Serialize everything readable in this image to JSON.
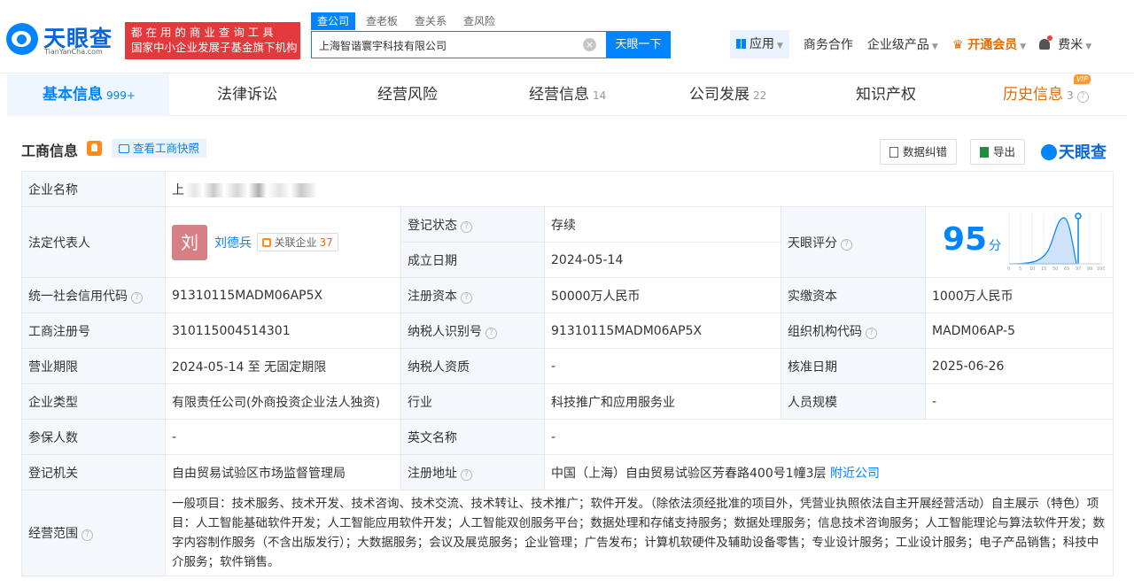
{
  "brand": {
    "name": "天眼查",
    "domain": "TianYanCha.com",
    "slogan_line1": "都 在 用 的 商 业 查 询 工 具",
    "slogan_line2": "国家中小企业发展子基金旗下机构"
  },
  "search": {
    "tabs": [
      "查公司",
      "查老板",
      "查关系",
      "查风险"
    ],
    "value": "上海智谐寰宇科技有限公司",
    "button": "天眼一下"
  },
  "nav": {
    "app": "应用",
    "items": [
      "商务合作",
      "企业级产品"
    ],
    "vip": "开通会员",
    "user": "费米"
  },
  "tabs": [
    {
      "label": "基本信息",
      "count": "999+"
    },
    {
      "label": "法律诉讼",
      "count": ""
    },
    {
      "label": "经营风险",
      "count": ""
    },
    {
      "label": "经营信息",
      "count": "14"
    },
    {
      "label": "公司发展",
      "count": "22"
    },
    {
      "label": "知识产权",
      "count": ""
    },
    {
      "label": "历史信息",
      "count": "3",
      "badge": "VIP"
    }
  ],
  "section": {
    "title": "工商信息",
    "snapshot": "查看工商快照",
    "correct": "数据纠错",
    "export": "导出",
    "brand": "天眼查"
  },
  "info": {
    "company_name_label": "企业名称",
    "company_name": "上",
    "legal_label": "法定代表人",
    "legal_avatar": "刘",
    "legal_name": "刘德兵",
    "related_label": "关联企业",
    "related_count": "37",
    "status_label": "登记状态",
    "status": "存续",
    "found_label": "成立日期",
    "found": "2024-05-14",
    "score_label": "天眼评分",
    "score": "95",
    "score_unit": "分",
    "score_ticks": [
      "0",
      "5",
      "10",
      "15",
      "50",
      "65",
      "97",
      "99",
      "100"
    ],
    "credit_label": "统一社会信用代码",
    "credit": "91310115MADM06AP5X",
    "capital_label": "注册资本",
    "capital": "50000万人民币",
    "paid_label": "实缴资本",
    "paid": "1000万人民币",
    "reg_label": "工商注册号",
    "reg": "310115004514301",
    "tax_label": "纳税人识别号",
    "tax": "91310115MADM06AP5X",
    "org_label": "组织机构代码",
    "org": "MADM06AP-5",
    "term_label": "营业期限",
    "term": "2024-05-14 至 无固定期限",
    "taxq_label": "纳税人资质",
    "taxq": "-",
    "approve_label": "核准日期",
    "approve": "2025-06-26",
    "type_label": "企业类型",
    "type": "有限责任公司(外商投资企业法人独资)",
    "industry_label": "行业",
    "industry": "科技推广和应用服务业",
    "staff_label": "人员规模",
    "staff": "-",
    "insured_label": "参保人数",
    "insured": "-",
    "en_label": "英文名称",
    "en": "-",
    "authority_label": "登记机关",
    "authority": "自由贸易试验区市场监督管理局",
    "addr_label": "注册地址",
    "addr": "中国（上海）自由贸易试验区芳春路400号1幢3层",
    "nearby": "附近公司",
    "scope_label": "经营范围",
    "scope": "一般项目：技术服务、技术开发、技术咨询、技术交流、技术转让、技术推广；软件开发。（除依法须经批准的项目外，凭营业执照依法自主开展经营活动）自主展示（特色）项目：人工智能基础软件开发；人工智能应用软件开发；人工智能双创服务平台；数据处理和存储支持服务；数据处理服务；信息技术咨询服务；人工智能理论与算法软件开发；数字内容制作服务（不含出版发行）；大数据服务；会议及展览服务；企业管理；广告发布；计算机软硬件及辅助设备零售；专业设计服务；工业设计服务；电子产品销售；科技中介服务；软件销售。"
  },
  "colors": {
    "primary": "#0084ff",
    "status_green": "#1f9a38",
    "vip_orange": "#e46b00",
    "slogan_red": "#e4393c"
  }
}
